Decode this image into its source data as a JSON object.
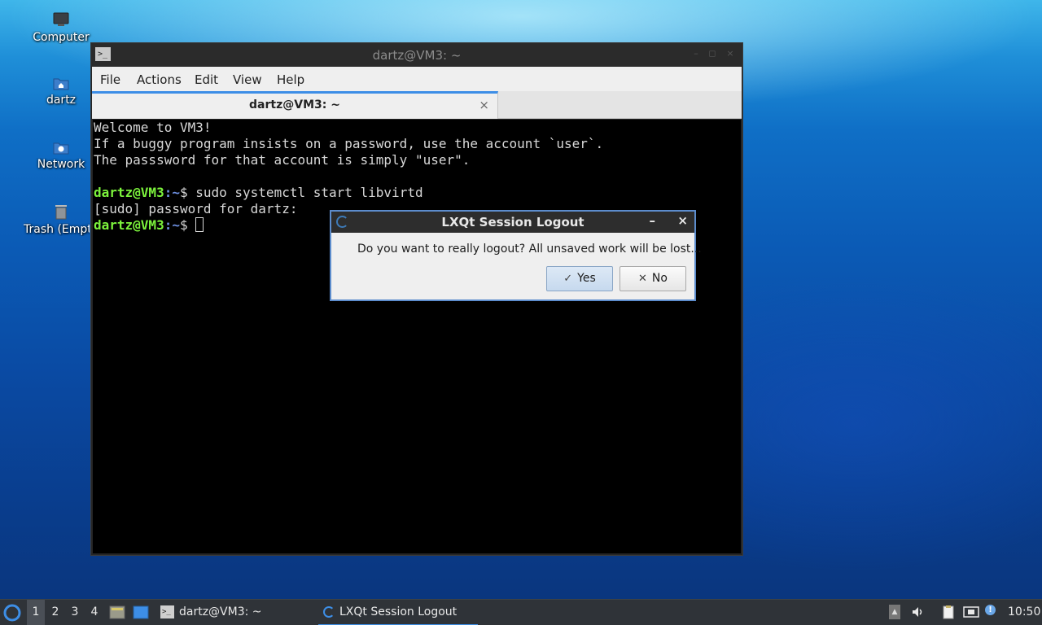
{
  "desktop": {
    "icons": [
      {
        "label": "Computer",
        "icon": "computer-icon"
      },
      {
        "label": "dartz",
        "icon": "home-folder-icon"
      },
      {
        "label": "Network",
        "icon": "network-folder-icon"
      },
      {
        "label": "Trash (Empty)",
        "icon": "trash-icon"
      }
    ]
  },
  "terminal": {
    "window_title": "dartz@VM3: ~",
    "menu": [
      "File",
      "Actions",
      "Edit",
      "View",
      "Help"
    ],
    "tab_label": "dartz@VM3: ~",
    "tab_close": "×",
    "lines": [
      "Welcome to VM3!",
      "If a buggy program insists on a password, use the account `user`.",
      "The passsword for that account is simply \"user\"."
    ],
    "prompt_user": "dartz@VM3",
    "prompt_path": ":~",
    "prompt_symbol": "$ ",
    "command": "sudo systemctl start libvirtd",
    "sudo_prompt": "[sudo] password for dartz:"
  },
  "dialog": {
    "title": "LXQt Session Logout",
    "message": "Do you want to really logout? All unsaved work will be lost...",
    "yes_label": "Yes",
    "no_label": "No",
    "minimize": "–",
    "close": "×"
  },
  "taskbar": {
    "workspaces": [
      "1",
      "2",
      "3",
      "4"
    ],
    "active_workspace": "1",
    "tasks": [
      {
        "label": "dartz@VM3: ~",
        "icon": "terminal-icon"
      },
      {
        "label": "LXQt Session Logout",
        "icon": "lxqt-icon",
        "active": true
      }
    ],
    "clock": "10:50"
  },
  "colors": {
    "accent": "#3d8ee6",
    "prompt_green": "#7cf33c",
    "prompt_blue": "#6d8fe0"
  }
}
